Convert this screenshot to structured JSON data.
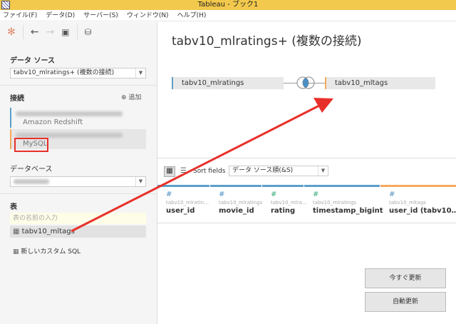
{
  "window": {
    "title": "Tableau - ブック1"
  },
  "menu": [
    "ファイル(F)",
    "データ(D)",
    "サーバー(S)",
    "ウィンドウ(N)",
    "ヘルプ(H)"
  ],
  "sidebar": {
    "datasource_label": "データ ソース",
    "datasource_value": "tabv10_mlratings+ (複数の接続)",
    "connections_label": "接続",
    "add_label": "追加",
    "connections": [
      {
        "type": "Amazon Redshift",
        "color": "#5b9fc9"
      },
      {
        "type": "MySQL",
        "color": "#f5a95c"
      }
    ],
    "database_label": "データベース",
    "table_label": "表",
    "table_search_placeholder": "表の名前の入力",
    "tables": [
      "tabv10_mltags"
    ],
    "custom_sql": "新しいカスタム SQL"
  },
  "main": {
    "title": "tabv10_mlratings+ (複数の接続)",
    "left_table": "tabv10_mlratings",
    "right_table": "tabv10_mltags",
    "sort_label": "Sort fields",
    "sort_value": "データ ソース順(&S)",
    "columns": [
      {
        "source": "tabv10_mlratin…",
        "name": "user_id",
        "color": "#4a8fc4",
        "bar": "#5b9fc9"
      },
      {
        "source": "tabv10_mlratings",
        "name": "movie_id",
        "color": "#4a8fc4",
        "bar": "#5b9fc9"
      },
      {
        "source": "tabv10_mlra…",
        "name": "rating",
        "color": "#3aaa7a",
        "bar": "#5b9fc9"
      },
      {
        "source": "tabv10_mlratings",
        "name": "timestamp_bigint",
        "color": "#3aaa7a",
        "bar": "#5b9fc9"
      },
      {
        "source": "tabv10_mltags",
        "name": "user_id (tabv10…",
        "color": "#4a8fc4",
        "bar": "#f5a95c"
      }
    ],
    "update_now": "今すぐ更新",
    "auto_update": "自動更新"
  }
}
